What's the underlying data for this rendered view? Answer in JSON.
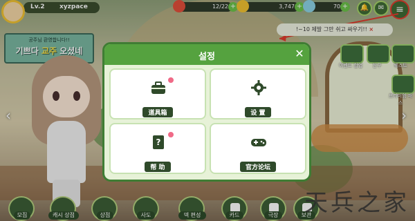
{
  "hud": {
    "level": "Lv.2",
    "username": "xyzpace",
    "stamina": "12/22",
    "coins": "3,747",
    "gems": "70"
  },
  "banner": {
    "subtitle": "공주님 환영합니다!!",
    "title_prefix": "기쁘다 ",
    "title_highlight": "교주",
    "title_suffix": " 오셨네"
  },
  "chat": {
    "mark": "!",
    "text": "!~10 제발 그만 쉬고 싸우기!!",
    "close": "×"
  },
  "side_menu": [
    {
      "label": "이벤트 합업",
      "icon": "event-icon"
    },
    {
      "label": "친구",
      "icon": "friend-icon"
    },
    {
      "label": "퀘스트",
      "icon": "quest-icon"
    },
    {
      "label": "프리미엄 패스",
      "icon": "pass-icon"
    }
  ],
  "dock": [
    {
      "label": "모집",
      "icon": "recruit-icon"
    },
    {
      "label": "캐시 상점",
      "icon": "cash-shop-icon"
    },
    {
      "label": "상점",
      "icon": "shop-icon"
    },
    {
      "label": "사도",
      "icon": "disciple-icon"
    },
    {
      "label": "덱 편성",
      "icon": "deck-icon"
    },
    {
      "label": "카드",
      "icon": "card-icon"
    },
    {
      "label": "극장",
      "icon": "theater-icon"
    },
    {
      "label": "보관",
      "icon": "storage-icon"
    }
  ],
  "modal": {
    "title": "설정",
    "close": "✕",
    "tiles": [
      {
        "label": "道具箱",
        "icon": "toolbox-icon"
      },
      {
        "label": "设 置",
        "icon": "gear-icon"
      },
      {
        "label": "帮 助",
        "icon": "help-book-icon"
      },
      {
        "label": "官方论坛",
        "icon": "gamepad-icon"
      }
    ]
  },
  "watermark": "天兵之家",
  "colors": {
    "accent": "#55a23f",
    "annotation": "#e03b2e"
  }
}
